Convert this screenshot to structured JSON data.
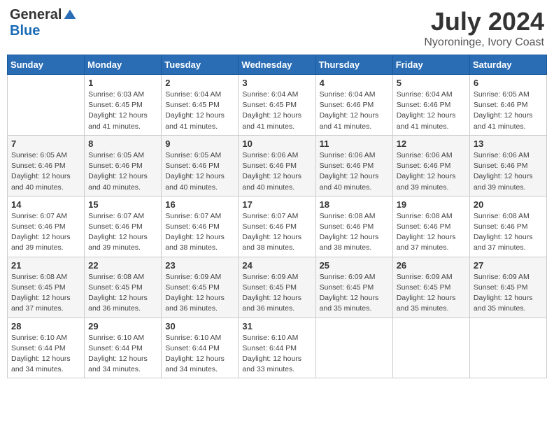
{
  "header": {
    "logo_general": "General",
    "logo_blue": "Blue",
    "month_year": "July 2024",
    "location": "Nyoroninge, Ivory Coast"
  },
  "calendar": {
    "weekdays": [
      "Sunday",
      "Monday",
      "Tuesday",
      "Wednesday",
      "Thursday",
      "Friday",
      "Saturday"
    ],
    "weeks": [
      [
        {
          "day": null,
          "info": null
        },
        {
          "day": "1",
          "info": "Sunrise: 6:03 AM\nSunset: 6:45 PM\nDaylight: 12 hours\nand 41 minutes."
        },
        {
          "day": "2",
          "info": "Sunrise: 6:04 AM\nSunset: 6:45 PM\nDaylight: 12 hours\nand 41 minutes."
        },
        {
          "day": "3",
          "info": "Sunrise: 6:04 AM\nSunset: 6:45 PM\nDaylight: 12 hours\nand 41 minutes."
        },
        {
          "day": "4",
          "info": "Sunrise: 6:04 AM\nSunset: 6:46 PM\nDaylight: 12 hours\nand 41 minutes."
        },
        {
          "day": "5",
          "info": "Sunrise: 6:04 AM\nSunset: 6:46 PM\nDaylight: 12 hours\nand 41 minutes."
        },
        {
          "day": "6",
          "info": "Sunrise: 6:05 AM\nSunset: 6:46 PM\nDaylight: 12 hours\nand 41 minutes."
        }
      ],
      [
        {
          "day": "7",
          "info": "Sunrise: 6:05 AM\nSunset: 6:46 PM\nDaylight: 12 hours\nand 40 minutes."
        },
        {
          "day": "8",
          "info": "Sunrise: 6:05 AM\nSunset: 6:46 PM\nDaylight: 12 hours\nand 40 minutes."
        },
        {
          "day": "9",
          "info": "Sunrise: 6:05 AM\nSunset: 6:46 PM\nDaylight: 12 hours\nand 40 minutes."
        },
        {
          "day": "10",
          "info": "Sunrise: 6:06 AM\nSunset: 6:46 PM\nDaylight: 12 hours\nand 40 minutes."
        },
        {
          "day": "11",
          "info": "Sunrise: 6:06 AM\nSunset: 6:46 PM\nDaylight: 12 hours\nand 40 minutes."
        },
        {
          "day": "12",
          "info": "Sunrise: 6:06 AM\nSunset: 6:46 PM\nDaylight: 12 hours\nand 39 minutes."
        },
        {
          "day": "13",
          "info": "Sunrise: 6:06 AM\nSunset: 6:46 PM\nDaylight: 12 hours\nand 39 minutes."
        }
      ],
      [
        {
          "day": "14",
          "info": "Sunrise: 6:07 AM\nSunset: 6:46 PM\nDaylight: 12 hours\nand 39 minutes."
        },
        {
          "day": "15",
          "info": "Sunrise: 6:07 AM\nSunset: 6:46 PM\nDaylight: 12 hours\nand 39 minutes."
        },
        {
          "day": "16",
          "info": "Sunrise: 6:07 AM\nSunset: 6:46 PM\nDaylight: 12 hours\nand 38 minutes."
        },
        {
          "day": "17",
          "info": "Sunrise: 6:07 AM\nSunset: 6:46 PM\nDaylight: 12 hours\nand 38 minutes."
        },
        {
          "day": "18",
          "info": "Sunrise: 6:08 AM\nSunset: 6:46 PM\nDaylight: 12 hours\nand 38 minutes."
        },
        {
          "day": "19",
          "info": "Sunrise: 6:08 AM\nSunset: 6:46 PM\nDaylight: 12 hours\nand 37 minutes."
        },
        {
          "day": "20",
          "info": "Sunrise: 6:08 AM\nSunset: 6:46 PM\nDaylight: 12 hours\nand 37 minutes."
        }
      ],
      [
        {
          "day": "21",
          "info": "Sunrise: 6:08 AM\nSunset: 6:45 PM\nDaylight: 12 hours\nand 37 minutes."
        },
        {
          "day": "22",
          "info": "Sunrise: 6:08 AM\nSunset: 6:45 PM\nDaylight: 12 hours\nand 36 minutes."
        },
        {
          "day": "23",
          "info": "Sunrise: 6:09 AM\nSunset: 6:45 PM\nDaylight: 12 hours\nand 36 minutes."
        },
        {
          "day": "24",
          "info": "Sunrise: 6:09 AM\nSunset: 6:45 PM\nDaylight: 12 hours\nand 36 minutes."
        },
        {
          "day": "25",
          "info": "Sunrise: 6:09 AM\nSunset: 6:45 PM\nDaylight: 12 hours\nand 35 minutes."
        },
        {
          "day": "26",
          "info": "Sunrise: 6:09 AM\nSunset: 6:45 PM\nDaylight: 12 hours\nand 35 minutes."
        },
        {
          "day": "27",
          "info": "Sunrise: 6:09 AM\nSunset: 6:45 PM\nDaylight: 12 hours\nand 35 minutes."
        }
      ],
      [
        {
          "day": "28",
          "info": "Sunrise: 6:10 AM\nSunset: 6:44 PM\nDaylight: 12 hours\nand 34 minutes."
        },
        {
          "day": "29",
          "info": "Sunrise: 6:10 AM\nSunset: 6:44 PM\nDaylight: 12 hours\nand 34 minutes."
        },
        {
          "day": "30",
          "info": "Sunrise: 6:10 AM\nSunset: 6:44 PM\nDaylight: 12 hours\nand 34 minutes."
        },
        {
          "day": "31",
          "info": "Sunrise: 6:10 AM\nSunset: 6:44 PM\nDaylight: 12 hours\nand 33 minutes."
        },
        {
          "day": null,
          "info": null
        },
        {
          "day": null,
          "info": null
        },
        {
          "day": null,
          "info": null
        }
      ]
    ]
  }
}
